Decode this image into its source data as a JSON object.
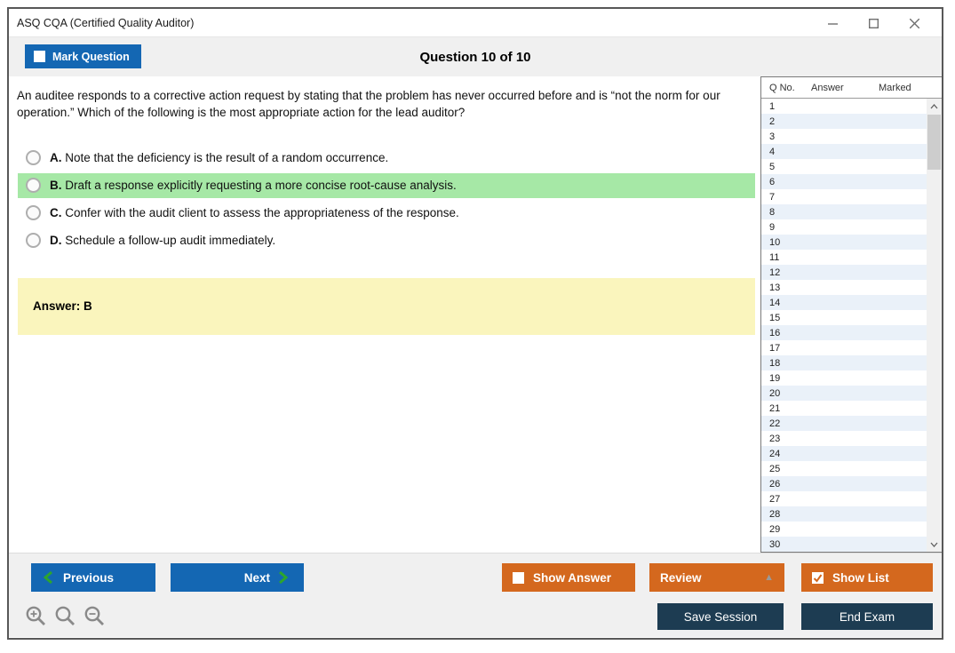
{
  "window": {
    "title": "ASQ CQA (Certified Quality Auditor)"
  },
  "header": {
    "mark_question_label": "Mark Question",
    "question_counter": "Question 10 of 10"
  },
  "question": {
    "text": "An auditee responds to a corrective action request by stating that the problem has never occurred before and is “not the norm for our operation.” Which of the following is the most appropriate action for the lead auditor?",
    "options": [
      {
        "letter": "A.",
        "text": "Note that the deficiency is the result of a random occurrence.",
        "highlighted": false
      },
      {
        "letter": "B.",
        "text": "Draft a response explicitly requesting a more concise root-cause analysis.",
        "highlighted": true
      },
      {
        "letter": "C.",
        "text": "Confer with the audit client to assess the appropriateness of the response.",
        "highlighted": false
      },
      {
        "letter": "D.",
        "text": "Schedule a follow-up audit immediately.",
        "highlighted": false
      }
    ],
    "answer_text": "Answer: B"
  },
  "question_list": {
    "columns": {
      "q_no": "Q No.",
      "answer": "Answer",
      "marked": "Marked"
    },
    "rows": [
      {
        "q_no": "1",
        "answer": "",
        "marked": ""
      },
      {
        "q_no": "2",
        "answer": "",
        "marked": ""
      },
      {
        "q_no": "3",
        "answer": "",
        "marked": ""
      },
      {
        "q_no": "4",
        "answer": "",
        "marked": ""
      },
      {
        "q_no": "5",
        "answer": "",
        "marked": ""
      },
      {
        "q_no": "6",
        "answer": "",
        "marked": ""
      },
      {
        "q_no": "7",
        "answer": "",
        "marked": ""
      },
      {
        "q_no": "8",
        "answer": "",
        "marked": ""
      },
      {
        "q_no": "9",
        "answer": "",
        "marked": ""
      },
      {
        "q_no": "10",
        "answer": "",
        "marked": ""
      },
      {
        "q_no": "11",
        "answer": "",
        "marked": ""
      },
      {
        "q_no": "12",
        "answer": "",
        "marked": ""
      },
      {
        "q_no": "13",
        "answer": "",
        "marked": ""
      },
      {
        "q_no": "14",
        "answer": "",
        "marked": ""
      },
      {
        "q_no": "15",
        "answer": "",
        "marked": ""
      },
      {
        "q_no": "16",
        "answer": "",
        "marked": ""
      },
      {
        "q_no": "17",
        "answer": "",
        "marked": ""
      },
      {
        "q_no": "18",
        "answer": "",
        "marked": ""
      },
      {
        "q_no": "19",
        "answer": "",
        "marked": ""
      },
      {
        "q_no": "20",
        "answer": "",
        "marked": ""
      },
      {
        "q_no": "21",
        "answer": "",
        "marked": ""
      },
      {
        "q_no": "22",
        "answer": "",
        "marked": ""
      },
      {
        "q_no": "23",
        "answer": "",
        "marked": ""
      },
      {
        "q_no": "24",
        "answer": "",
        "marked": ""
      },
      {
        "q_no": "25",
        "answer": "",
        "marked": ""
      },
      {
        "q_no": "26",
        "answer": "",
        "marked": ""
      },
      {
        "q_no": "27",
        "answer": "",
        "marked": ""
      },
      {
        "q_no": "28",
        "answer": "",
        "marked": ""
      },
      {
        "q_no": "29",
        "answer": "",
        "marked": ""
      },
      {
        "q_no": "30",
        "answer": "",
        "marked": ""
      }
    ]
  },
  "footer": {
    "previous_label": "Previous",
    "next_label": "Next",
    "show_answer_label": "Show Answer",
    "review_label": "Review",
    "show_list_label": "Show List",
    "save_session_label": "Save Session",
    "end_exam_label": "End Exam"
  },
  "state": {
    "mark_question_checked": false,
    "show_answer_checked": false,
    "show_list_checked": true
  },
  "colors": {
    "accent_blue": "#1467b3",
    "accent_orange": "#d4681e",
    "navy": "#1d3c52",
    "highlight_green": "#a6e8a6",
    "answer_yellow": "#faf5bd",
    "row_alt_blue": "#eaf1f9",
    "chevron_green": "#2da52d"
  }
}
